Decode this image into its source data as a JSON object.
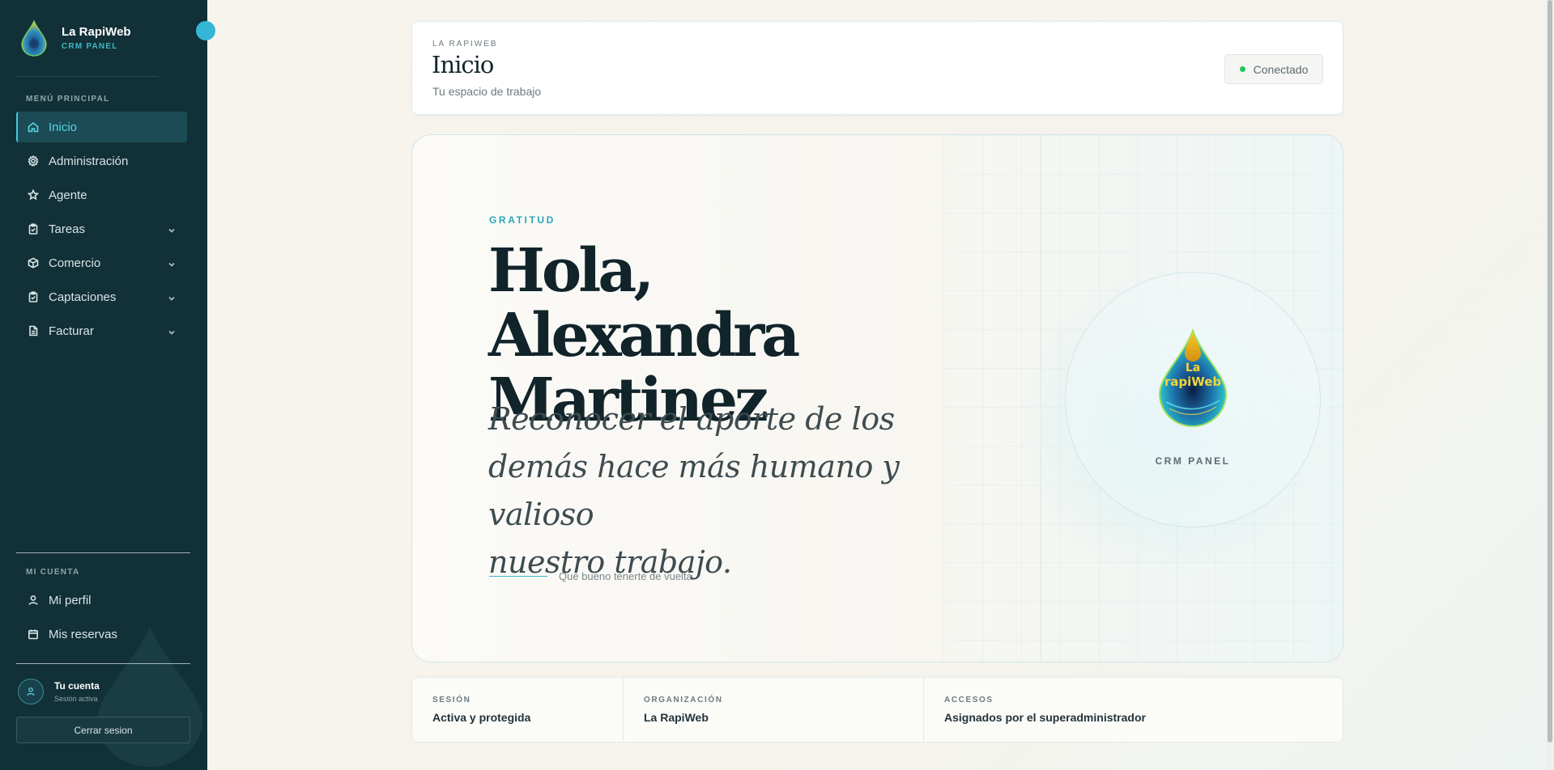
{
  "sidebar": {
    "brand": {
      "name": "La RapiWeb",
      "subtitle": "CRM PANEL"
    },
    "main_menu_label": "MENÚ PRINCIPAL",
    "items": [
      {
        "label": "Inicio",
        "icon": "home-icon",
        "active": true,
        "has_submenu": false
      },
      {
        "label": "Administración",
        "icon": "gear-icon",
        "active": false,
        "has_submenu": false
      },
      {
        "label": "Agente",
        "icon": "star-icon",
        "active": false,
        "has_submenu": false
      },
      {
        "label": "Tareas",
        "icon": "clipboard-icon",
        "active": false,
        "has_submenu": true
      },
      {
        "label": "Comercio",
        "icon": "box-icon",
        "active": false,
        "has_submenu": true
      },
      {
        "label": "Captaciones",
        "icon": "clipboard-icon",
        "active": false,
        "has_submenu": true
      },
      {
        "label": "Facturar",
        "icon": "document-icon",
        "active": false,
        "has_submenu": true
      }
    ],
    "account_section_label": "MI CUENTA",
    "account_items": [
      {
        "label": "Mi perfil",
        "icon": "user-icon"
      },
      {
        "label": "Mis reservas",
        "icon": "calendar-icon"
      }
    ],
    "account": {
      "title": "Tu cuenta",
      "subtitle": "Sesión activa"
    },
    "logout_label": "Cerrar sesion"
  },
  "header": {
    "eyebrow": "LA RAPIWEB",
    "title": "Inicio",
    "subtitle": "Tu espacio de trabajo",
    "status": "Conectado",
    "status_color": "#22c55e"
  },
  "hero": {
    "eyebrow": "GRATITUD",
    "greeting_line1": "Hola, Alexandra",
    "greeting_line2": "Martinez",
    "quote_line1": "Reconocer el aporte de los",
    "quote_line2": "demás hace más humano y valioso",
    "quote_line3": "nuestro trabajo.",
    "signoff": "Qué bueno tenerte de vuelta.",
    "badge": "CRM PANEL",
    "logo_text_1": "La",
    "logo_text_2": "rapiWeb"
  },
  "info": [
    {
      "label": "SESIÓN",
      "value": "Activa y protegida"
    },
    {
      "label": "ORGANIZACIÓN",
      "value": "La RapiWeb"
    },
    {
      "label": "ACCESOS",
      "value": "Asignados por el superadministrador"
    }
  ],
  "colors": {
    "sidebar_bg": "#123037",
    "accent": "#3fb7c9",
    "active_bg": "#1b4b55"
  }
}
